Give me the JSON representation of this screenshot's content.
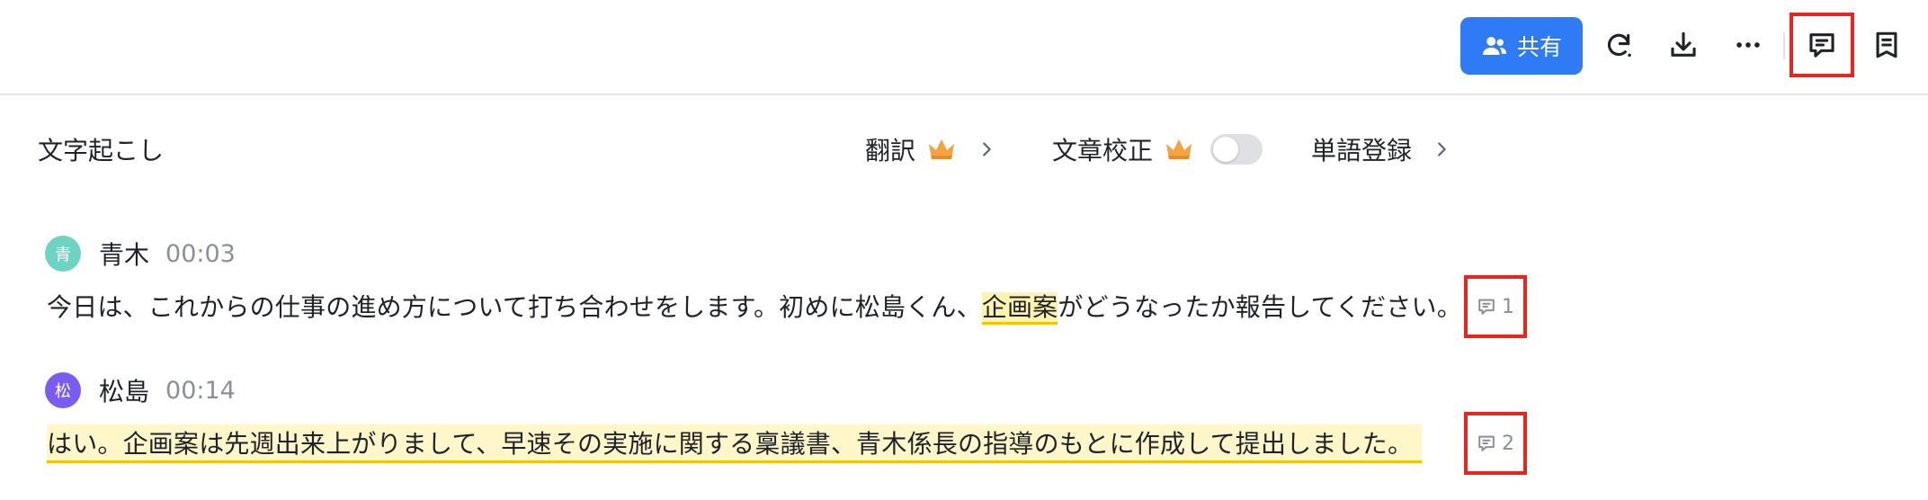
{
  "toolbar": {
    "share_label": "共有",
    "icons": [
      "users-icon",
      "sync-icon",
      "download-icon",
      "more-icon",
      "comment-panel-icon",
      "notes-icon"
    ]
  },
  "section": {
    "title": "文字起こし",
    "translate_label": "翻訳",
    "proofread_label": "文章校正",
    "proofread_enabled": false,
    "dictionary_label": "単語登録"
  },
  "transcript": [
    {
      "avatar": "青",
      "avatar_color": "#6fd3c4",
      "speaker": "青木",
      "time": "00:03",
      "text_before": "今日は、これからの仕事の進め方について打ち合わせをします。初めに松島くん、",
      "text_highlight": "企画案",
      "text_after": "がどうなったか報告してください。",
      "comment_count": "1"
    },
    {
      "avatar": "松",
      "avatar_color": "#7b5cf0",
      "speaker": "松島",
      "time": "00:14",
      "text": "はい。企画案は先週出来上がりまして、早速その実施に関する稟議書、青木係長の指導のもとに作成して提出しました。",
      "comment_count": "2"
    }
  ],
  "colors": {
    "accent": "#2f7bf6",
    "highlight": "#fff3b0",
    "callout": "#e8261f"
  }
}
